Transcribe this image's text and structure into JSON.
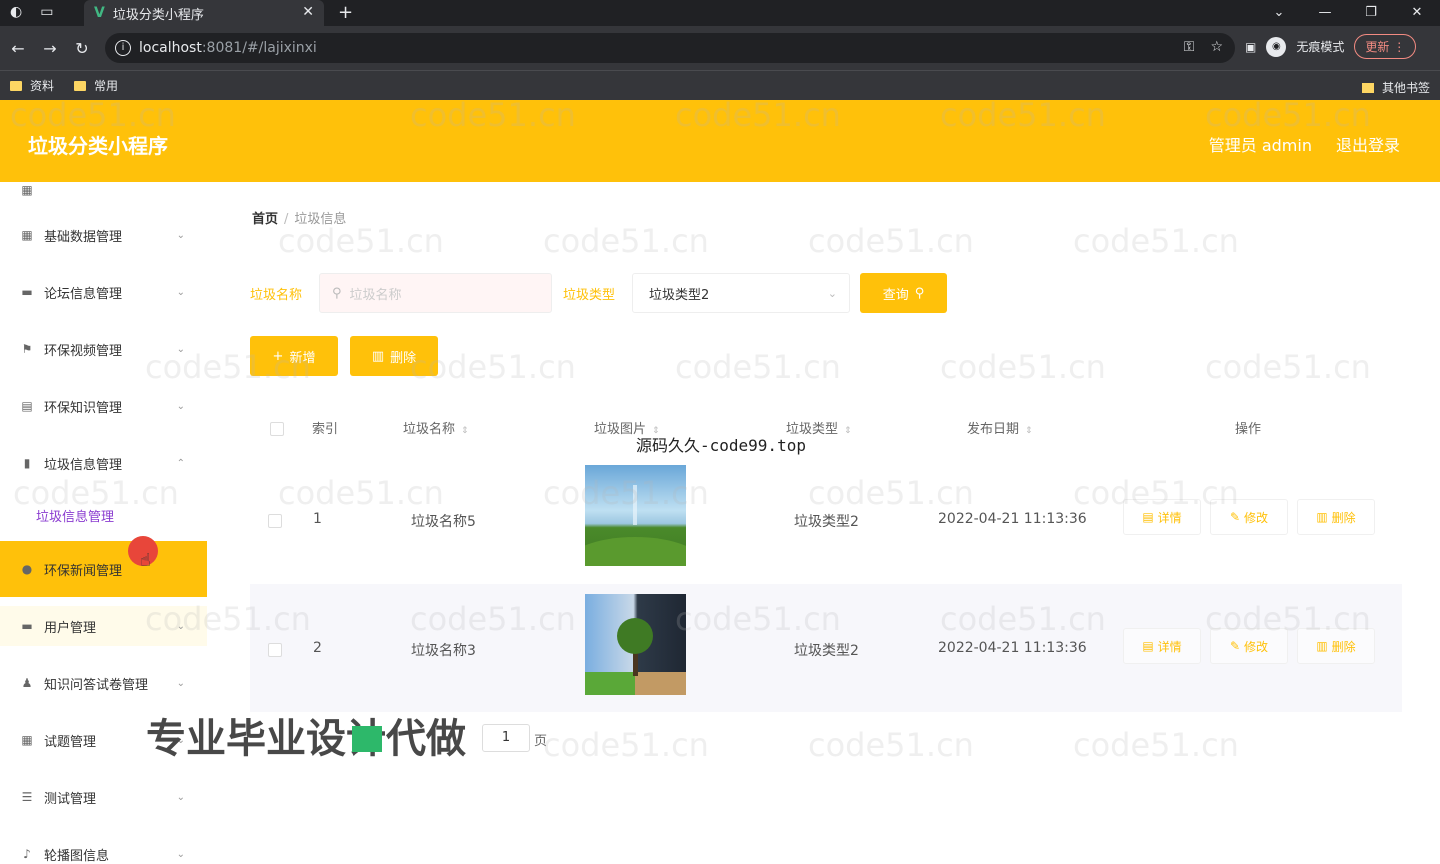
{
  "browser": {
    "tab_title": "垃圾分类小程序",
    "url_host": "localhost",
    "url_path": ":8081/#/lajixinxi",
    "incognito_label": "无痕模式",
    "update_label": "更新",
    "bookmarks": [
      "资料",
      "常用"
    ],
    "other_bookmarks": "其他书签"
  },
  "header": {
    "title": "垃圾分类小程序",
    "user": "管理员 admin",
    "logout": "退出登录"
  },
  "sidebar": {
    "items": [
      {
        "label": "基础数据管理"
      },
      {
        "label": "论坛信息管理"
      },
      {
        "label": "环保视频管理"
      },
      {
        "label": "环保知识管理"
      },
      {
        "label": "垃圾信息管理"
      },
      {
        "label": "环保新闻管理"
      },
      {
        "label": "用户管理"
      },
      {
        "label": "知识问答试卷管理"
      },
      {
        "label": "试题管理"
      },
      {
        "label": "测试管理"
      },
      {
        "label": "轮播图信息"
      }
    ],
    "submenu": "垃圾信息管理"
  },
  "breadcrumb": {
    "home": "首页",
    "current": "垃圾信息"
  },
  "search": {
    "name_label": "垃圾名称",
    "name_placeholder": "垃圾名称",
    "type_label": "垃圾类型",
    "type_value": "垃圾类型2",
    "query_button": "查询"
  },
  "toolbar": {
    "add_button": "新增",
    "delete_button": "删除"
  },
  "table": {
    "columns": [
      "索引",
      "垃圾名称",
      "垃圾图片",
      "垃圾类型",
      "发布日期",
      "操作"
    ],
    "rows": [
      {
        "index": "1",
        "name": "垃圾名称5",
        "type": "垃圾类型2",
        "date": "2022-04-21 11:13:36"
      },
      {
        "index": "2",
        "name": "垃圾名称3",
        "type": "垃圾类型2",
        "date": "2022-04-21 11:13:36"
      }
    ],
    "actions": {
      "detail": "详情",
      "edit": "修改",
      "delete": "删除"
    }
  },
  "pagination": {
    "page_value": "1",
    "page_suffix": "页"
  },
  "overlays": {
    "source_text": "源码久久-code99.top",
    "banner": "专业毕业设计代做",
    "watermark": "code51.cn"
  }
}
